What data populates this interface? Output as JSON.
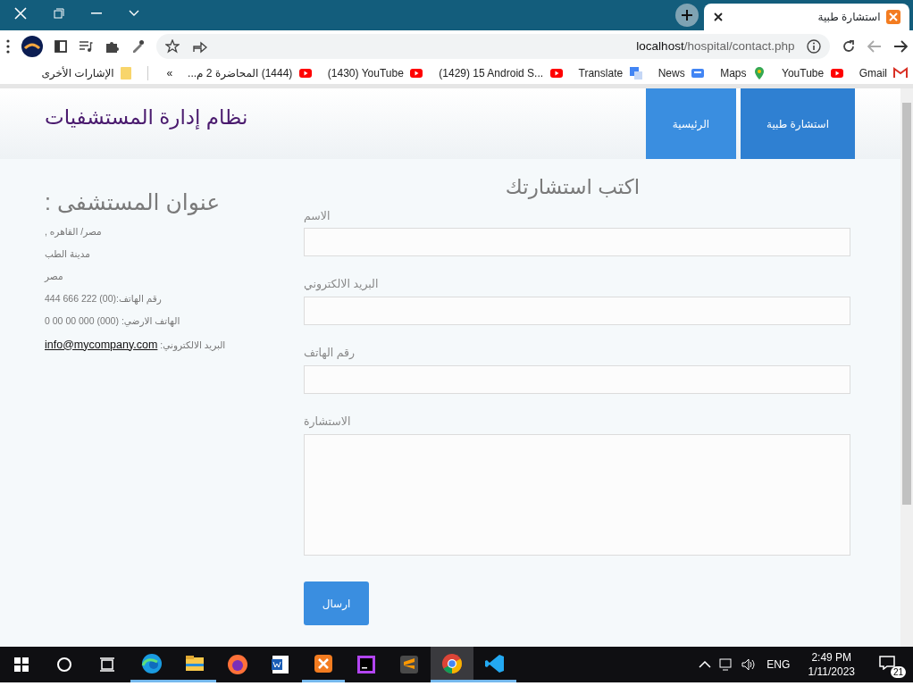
{
  "browser": {
    "tabs": [
      {
        "title": "استشارة طبية",
        "selected": true
      }
    ],
    "url": {
      "host": "localhost",
      "path": "/hospital/contact.php"
    },
    "bookmarks": [
      {
        "label": "Gmail",
        "kind": "gmail"
      },
      {
        "label": "YouTube",
        "kind": "youtube"
      },
      {
        "label": "Maps",
        "kind": "maps"
      },
      {
        "label": "News",
        "kind": "news"
      },
      {
        "label": "Translate",
        "kind": "translate"
      },
      {
        "label": "(1429) 15 Android S...",
        "kind": "youtube"
      },
      {
        "label": "(1430) YouTube",
        "kind": "youtube"
      },
      {
        "label": "(1444) المحاضرة 2 م...",
        "kind": "youtube"
      }
    ],
    "more": "»",
    "other_bookmarks": "الإشارات الأخرى"
  },
  "page": {
    "site_title": "نظام إدارة المستشفيات",
    "nav": [
      {
        "label": "استشارة طبية",
        "selected": true
      },
      {
        "label": "الرئيسية",
        "selected": false
      }
    ],
    "contact": {
      "heading": "عنوان المستشفى :",
      "lines": [
        "مصر/ القاهره ,",
        "مدينة الطب",
        "مصر",
        "رقم الهاتف:(00) 222 666 444",
        "الهاتف الارضي: (000) 000 00 00 0"
      ],
      "email_label": "البريد الالكتروني:",
      "email": "info@mycompany.com"
    },
    "form": {
      "heading": "اكتب استشارتك",
      "fields": [
        {
          "label": "الاسم",
          "kind": "input"
        },
        {
          "label": "البريد الالكتروني",
          "kind": "input"
        },
        {
          "label": "رقم الهاتف",
          "kind": "input"
        },
        {
          "label": "الاستشارة",
          "kind": "textarea"
        }
      ],
      "submit": "ارسال"
    }
  },
  "taskbar": {
    "apps": [
      {
        "kind": "edge",
        "running": true,
        "active": false
      },
      {
        "kind": "explorer",
        "running": true,
        "active": false
      },
      {
        "kind": "firefox",
        "running": false,
        "active": false
      },
      {
        "kind": "word",
        "running": false,
        "active": false
      },
      {
        "kind": "xampp",
        "running": true,
        "active": false
      },
      {
        "kind": "phpstorm",
        "running": false,
        "active": false
      },
      {
        "kind": "sublime",
        "running": false,
        "active": false
      },
      {
        "kind": "chrome",
        "running": true,
        "active": true
      },
      {
        "kind": "vscode",
        "running": true,
        "active": false
      }
    ],
    "language": "ENG",
    "time": "2:49 PM",
    "date": "1/11/2023",
    "notifications": "21"
  }
}
